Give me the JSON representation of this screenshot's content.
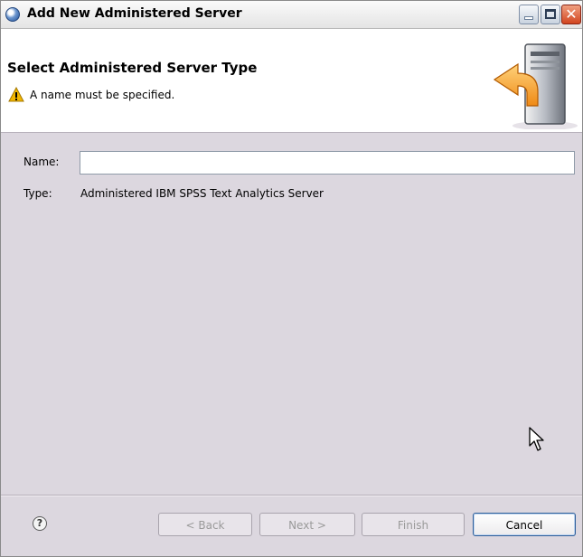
{
  "window": {
    "title": "Add New Administered Server",
    "controls": [
      "minimize",
      "maximize",
      "close"
    ],
    "close_glyph": "✕"
  },
  "banner": {
    "title": "Select Administered Server Type",
    "message": "A name must be specified.",
    "message_icon": "warning-icon",
    "graphic": "server-add-wizard-icon"
  },
  "form": {
    "name_label": "Name:",
    "name_value": "",
    "type_label": "Type:",
    "type_value": "Administered IBM SPSS Text Analytics Server"
  },
  "footer": {
    "help_glyph": "?",
    "back_label": "< Back",
    "next_label": "Next >",
    "finish_label": "Finish",
    "cancel_label": "Cancel"
  },
  "colors": {
    "dialog_bg": "#dcd7df",
    "banner_bg": "#ffffff",
    "disabled_text": "#9a9a9a",
    "default_button_border": "#2f5f9a",
    "warning": "#f2b600",
    "arrow": "#f39a2a"
  }
}
